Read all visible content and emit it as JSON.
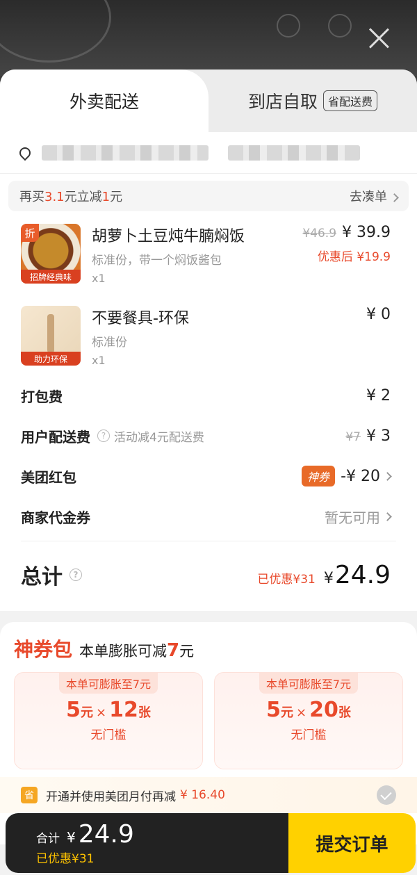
{
  "tabs": {
    "delivery": "外卖配送",
    "pickup": "到店自取",
    "pickup_badge": "省配送费"
  },
  "promo": {
    "pre": "再买",
    "amount": "3.1",
    "mid": "元立减",
    "discount": "1",
    "post": "元",
    "action": "去凑单"
  },
  "items": [
    {
      "name": "胡萝卜土豆炖牛腩焖饭",
      "spec": "标准份，带一个焖饭酱包",
      "qty": "x1",
      "orig_price": "¥46.9",
      "price": "¥ 39.9",
      "after_discount": "优惠后 ¥19.9",
      "badge": "折",
      "tag": "招牌经典味"
    },
    {
      "name": "不要餐具-环保",
      "spec": "标准份",
      "qty": "x1",
      "price": "¥ 0",
      "tag": "助力环保"
    }
  ],
  "fees": {
    "packing_label": "打包费",
    "packing_value": "¥ 2",
    "delivery_label": "用户配送费",
    "delivery_note": "活动减4元配送费",
    "delivery_orig": "¥7",
    "delivery_value": "¥ 3",
    "redpacket_label": "美团红包",
    "redpacket_badge": "神券",
    "redpacket_value": "-¥ 20",
    "voucher_label": "商家代金券",
    "voucher_value": "暂无可用"
  },
  "total": {
    "label": "总计",
    "saved": "已优惠¥31",
    "currency": "¥",
    "amount": "24.9"
  },
  "package": {
    "name": "神券包",
    "desc_pre": "本单膨胀可减",
    "desc_amount": "7",
    "desc_post": "元",
    "coupons": [
      {
        "badge": "本单可膨胀至7元",
        "value": "5",
        "unit": "元",
        "times": "×",
        "count": "12",
        "count_unit": "张",
        "threshold": "无门槛"
      },
      {
        "badge": "本单可膨胀至7元",
        "value": "5",
        "unit": "元",
        "times": "×",
        "count": "20",
        "count_unit": "张",
        "threshold": "无门槛"
      }
    ]
  },
  "monthly": {
    "icon_text": "省",
    "text": "开通并使用美团月付再减",
    "amount": "¥ 16.40"
  },
  "bottom": {
    "total_label": "合计",
    "currency": "¥",
    "amount": "24.9",
    "saved": "已优惠¥31",
    "submit": "提交订单"
  },
  "colors": {
    "accent_red": "#e8492b",
    "submit_yellow": "#ffd100",
    "bar_dark": "#222222"
  }
}
